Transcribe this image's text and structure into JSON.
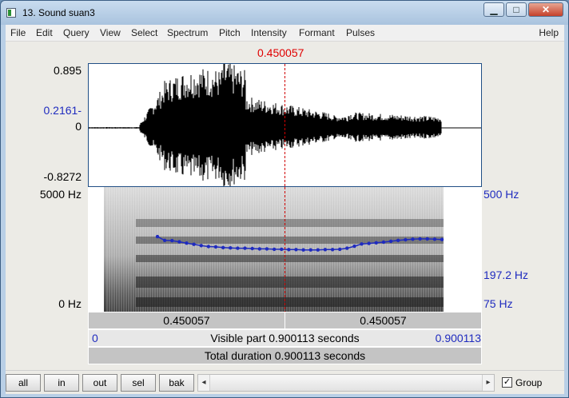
{
  "window": {
    "title": "13. Sound suan3",
    "minimize": "▁",
    "maximize": "□",
    "close": "✕"
  },
  "menu": [
    "File",
    "Edit",
    "Query",
    "View",
    "Select",
    "Spectrum",
    "Pitch",
    "Intensity",
    "Formant",
    "Pulses"
  ],
  "help": "Help",
  "cursor": {
    "time": "0.450057",
    "fraction": 0.5
  },
  "waveform": {
    "y_max": "0.895",
    "y_cursor": "0.2161",
    "y_zero": "0",
    "y_min": "-0.8272"
  },
  "spectrogram": {
    "freq_max": "5000 Hz",
    "freq_min": "0 Hz"
  },
  "pitch": {
    "ceiling": "500 Hz",
    "value_at_cursor": "197.2 Hz",
    "floor": "75 Hz",
    "contour_hz": [
      235,
      222,
      221,
      217,
      213,
      209,
      205,
      202,
      201,
      199,
      198,
      197,
      197,
      196,
      195,
      195,
      194,
      194,
      193,
      193,
      192,
      192,
      192,
      193,
      193,
      194,
      197,
      203,
      210,
      212,
      214,
      216,
      219,
      222,
      224,
      226,
      227,
      227,
      226,
      225
    ]
  },
  "time_axis": {
    "left_value": "0.450057",
    "right_value": "0.450057"
  },
  "visible_part": {
    "start": "0",
    "label": "Visible part 0.900113 seconds",
    "end": "0.900113"
  },
  "total_duration": "Total duration 0.900113 seconds",
  "buttons": [
    "all",
    "in",
    "out",
    "sel",
    "bak"
  ],
  "group": {
    "label": "Group",
    "checked": true,
    "mark": "✓"
  },
  "scroll_arrows": {
    "left": "◂",
    "right": "▸"
  }
}
